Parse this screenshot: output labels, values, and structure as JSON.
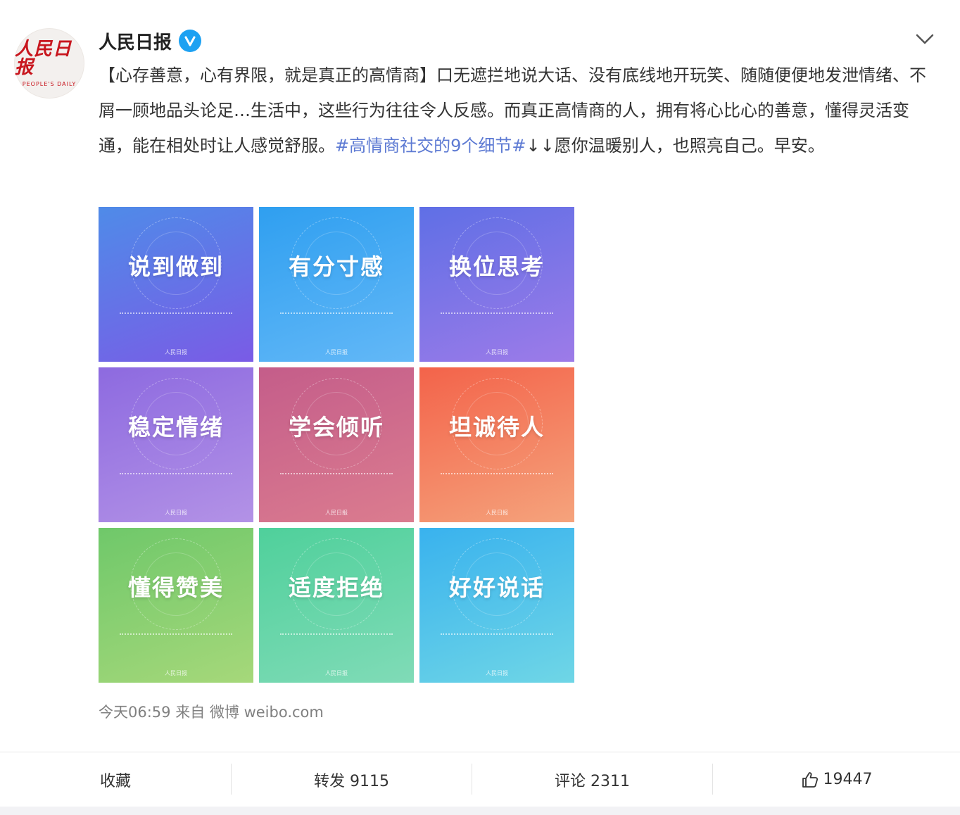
{
  "post": {
    "avatar": {
      "logo_text": "人民日报",
      "logo_sub": "PEOPLE'S DAILY"
    },
    "username": "人民日报",
    "text_part1": "【心存善意，心有界限，就是真正的高情商】口无遮拦地说大话、没有底线地开玩笑、随随便便地发泄情绪、不屑一顾地品头论足…生活中，这些行为往往令人反感。而真正高情商的人，拥有将心比心的善意，懂得灵活变通，能在相处时让人感觉舒服。",
    "topic": "#高情商社交的9个细节#",
    "text_part2": "↓↓愿你温暖别人，也照亮自己。早安。",
    "images": [
      {
        "title": "说到做到",
        "color1": "#4f8be8",
        "color2": "#7a5be6"
      },
      {
        "title": "有分寸感",
        "color1": "#2f9ff0",
        "color2": "#63b8f7"
      },
      {
        "title": "换位思考",
        "color1": "#5f6fe6",
        "color2": "#9d7be8"
      },
      {
        "title": "稳定情绪",
        "color1": "#8d6ae0",
        "color2": "#b392e6"
      },
      {
        "title": "学会倾听",
        "color1": "#c45d8a",
        "color2": "#db7c8f"
      },
      {
        "title": "坦诚待人",
        "color1": "#f3634a",
        "color2": "#f5a37c"
      },
      {
        "title": "懂得赞美",
        "color1": "#6fc86a",
        "color2": "#a6d87a"
      },
      {
        "title": "适度拒绝",
        "color1": "#4fd09b",
        "color2": "#80dbb7"
      },
      {
        "title": "好好说话",
        "color1": "#39b2ee",
        "color2": "#6fd6e6"
      }
    ],
    "image_brand": "人民日报",
    "meta": {
      "time": "今天06:59",
      "from": "来自",
      "source": "微博 weibo.com"
    }
  },
  "actions": {
    "favorite": "收藏",
    "repost": "转发 9115",
    "comment": "评论 2311",
    "like": "19447"
  },
  "colors": {
    "topic": "#5d7ad3",
    "verified": "#1da1f2",
    "logo_red": "#c8161e"
  },
  "icons": [
    "verified-icon",
    "chevron-down-icon",
    "thumbs-up-icon"
  ]
}
